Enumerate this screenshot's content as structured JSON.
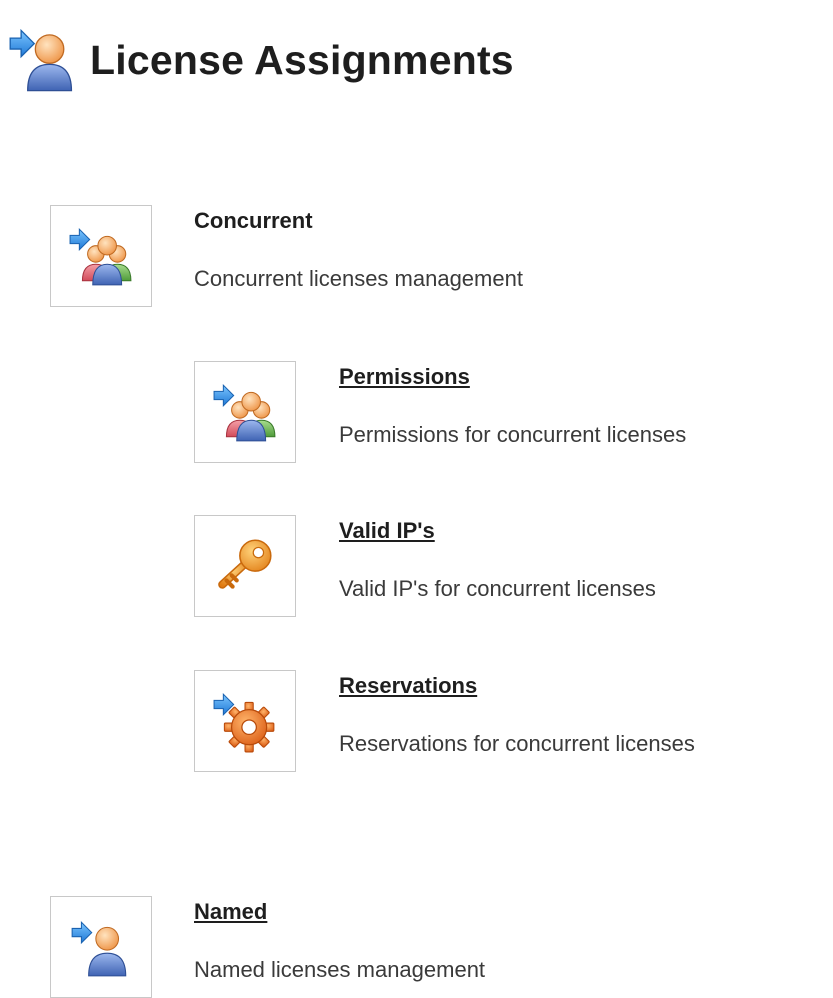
{
  "page": {
    "title": "License Assignments",
    "icon": "user-arrow-icon"
  },
  "sections": [
    {
      "title": "Concurrent",
      "description": "Concurrent licenses management",
      "icon": "group-arrow-icon",
      "is_link": false
    },
    {
      "title": "Named",
      "description": "Named licenses management",
      "icon": "user-arrow-icon",
      "is_link": true
    }
  ],
  "concurrent_items": [
    {
      "title": "Permissions",
      "description": "Permissions for concurrent licenses",
      "icon": "group-arrow-icon"
    },
    {
      "title": "Valid IP's",
      "description": "Valid IP's for concurrent licenses",
      "icon": "key-icon"
    },
    {
      "title": "Reservations",
      "description": "Reservations for concurrent licenses",
      "icon": "gear-arrow-icon"
    }
  ],
  "colors": {
    "arrow_blue": "#2f8ee6",
    "user_orange": "#f2a45a",
    "user_blue": "#5b7fc7",
    "key_orange": "#f29a2e",
    "gear_orange": "#f07a25",
    "tile_border": "#c8c8c8"
  }
}
